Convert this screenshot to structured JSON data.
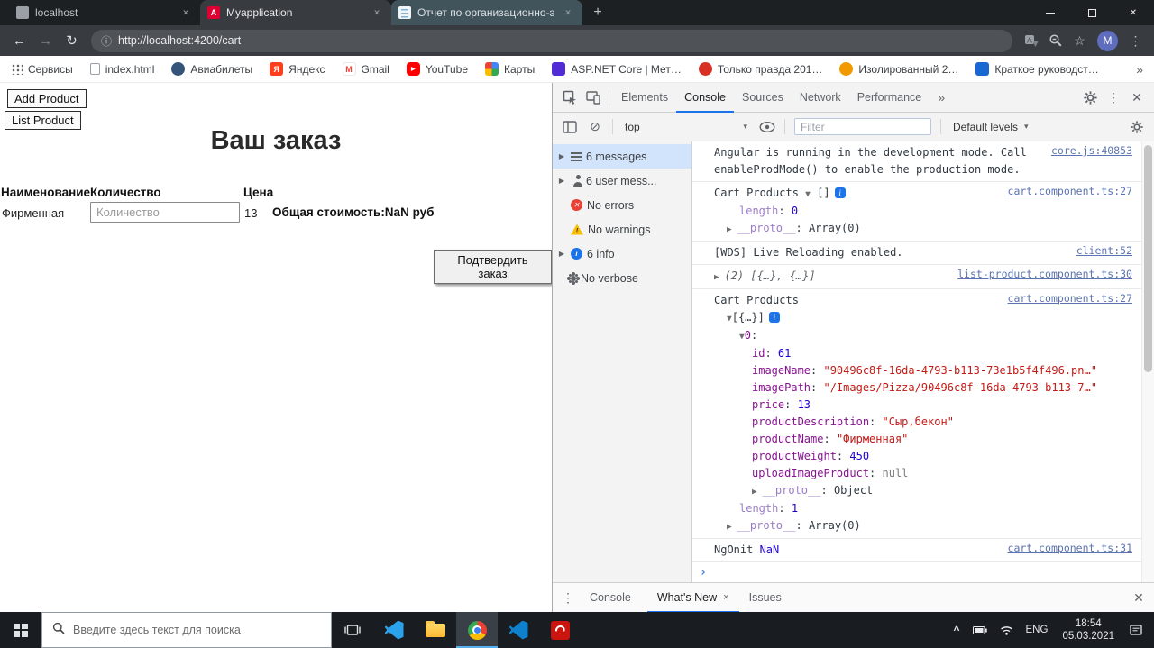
{
  "icons": {
    "new_tab": "+",
    "back": "←",
    "forward": "→",
    "reload": "↻",
    "info": "ⓘ",
    "star": "☆",
    "menu_dots": "⋮",
    "close": "✕",
    "overflow": "»",
    "caret_down": "▾",
    "block": "⊘",
    "prompt": "›",
    "chevron_up": "^"
  },
  "browser": {
    "tabs": [
      {
        "title": "localhost",
        "fav": "fav-page",
        "letter": ""
      },
      {
        "title": "Myapplication",
        "fav": "fav-angular",
        "letter": "A",
        "cls": "active"
      },
      {
        "title": "Отчет по организационно-экон",
        "fav": "fav-doc",
        "letter": "",
        "cls": "alt"
      }
    ],
    "url": "http://localhost:4200/cart",
    "profile_initial": "M",
    "bookmarks": [
      {
        "label": "Сервисы",
        "ic": "bm-apps"
      },
      {
        "label": "index.html",
        "ic": "bm-file"
      },
      {
        "label": "Авиабилеты",
        "ic": "bm-globe"
      },
      {
        "label": "Яндекс",
        "ic": "bm-yandex",
        "glyph": "Я"
      },
      {
        "label": "Gmail",
        "ic": "bm-gmail",
        "glyph": "M"
      },
      {
        "label": "YouTube",
        "ic": "bm-youtube",
        "glyph": "▶"
      },
      {
        "label": "Карты",
        "ic": "bm-maps"
      },
      {
        "label": "ASP.NET Core | Мет…",
        "ic": "bm-ms"
      },
      {
        "label": "Только правда 201…",
        "ic": "bm-red"
      },
      {
        "label": "Изолированный 2…",
        "ic": "bm-orange"
      },
      {
        "label": "Краткое руководст…",
        "ic": "bm-blue"
      }
    ]
  },
  "page": {
    "add_product_button": "Add Product",
    "list_product_button": "List Product",
    "title": "Ваш заказ",
    "headers": {
      "name": "Наименование",
      "qty": "Количество",
      "price": "Цена"
    },
    "row": {
      "name": "Фирменная",
      "qty_placeholder": "Количество",
      "price": "13"
    },
    "total": "Общая стоимость:NaN руб",
    "confirm_button": "Подтвердить заказ"
  },
  "devtools": {
    "tabs": [
      {
        "label": "Elements"
      },
      {
        "label": "Console",
        "cls": "active"
      },
      {
        "label": "Sources"
      },
      {
        "label": "Network"
      },
      {
        "label": "Performance"
      }
    ],
    "toolbar": {
      "context": "top",
      "filter_placeholder": "Filter",
      "levels_label": "Default levels"
    },
    "sidebar": [
      {
        "label": "6 messages",
        "ic": "ic-list",
        "caret": "▶",
        "cls": "selected"
      },
      {
        "label": "6 user mess...",
        "ic": "ic-user",
        "caret": "▶"
      },
      {
        "label": "No errors",
        "ic": "ic-error",
        "glyph": "✕"
      },
      {
        "label": "No warnings",
        "ic": "ic-warning",
        "glyph": "!"
      },
      {
        "label": "6 info",
        "ic": "ic-info",
        "glyph": "i",
        "caret": "▶"
      },
      {
        "label": "No verbose",
        "ic": "ic-verbose"
      }
    ],
    "entries": [
      {
        "link": "core.js:40853",
        "rows": [
          {
            "indent": 0,
            "parts": [
              {
                "t": "Angular is running in the development mode. Call enableProdMode() to enable the production mode.",
                "c": "tk-plain"
              }
            ]
          }
        ]
      },
      {
        "link": "cart.component.ts:27",
        "rows": [
          {
            "indent": 0,
            "parts": [
              {
                "t": "Cart Products ",
                "c": "tk-plain"
              },
              {
                "t": "▼",
                "c": "tk-caret"
              },
              {
                "t": " []",
                "c": "tk-plain"
              },
              {
                "t": "i",
                "c": "tk-badge"
              }
            ]
          },
          {
            "indent": 2,
            "parts": [
              {
                "t": "length",
                "c": "tk-dimkey"
              },
              {
                "t": ": ",
                "c": "tk-plain"
              },
              {
                "t": "0",
                "c": "tk-number"
              }
            ]
          },
          {
            "indent": 1,
            "parts": [
              {
                "t": "▶ ",
                "c": "tk-caret"
              },
              {
                "t": "__proto__",
                "c": "tk-dimkey"
              },
              {
                "t": ": ",
                "c": "tk-plain"
              },
              {
                "t": "Array(0)",
                "c": "tk-plain"
              }
            ]
          }
        ]
      },
      {
        "link": "client:52",
        "rows": [
          {
            "indent": 0,
            "parts": [
              {
                "t": "[WDS] Live Reloading enabled.",
                "c": "tk-plain"
              }
            ]
          }
        ]
      },
      {
        "link": "list-product.component.ts:30",
        "rows": [
          {
            "indent": 0,
            "parts": [
              {
                "t": "▶ ",
                "c": "tk-caret"
              },
              {
                "t": "(2) [{…}, {…}]",
                "c": "tk-preview"
              }
            ]
          }
        ]
      },
      {
        "link": "cart.component.ts:27",
        "rows": [
          {
            "indent": 0,
            "parts": [
              {
                "t": "Cart Products",
                "c": "tk-plain"
              }
            ]
          },
          {
            "indent": 1,
            "parts": [
              {
                "t": "▼",
                "c": "tk-caret"
              },
              {
                "t": "[{…}]",
                "c": "tk-plain"
              },
              {
                "t": "i",
                "c": "tk-badge"
              }
            ]
          },
          {
            "indent": 2,
            "parts": [
              {
                "t": "▼",
                "c": "tk-caret"
              },
              {
                "t": "0",
                "c": "tk-key"
              },
              {
                "t": ":",
                "c": "tk-plain"
              }
            ]
          },
          {
            "indent": 3,
            "parts": [
              {
                "t": "id",
                "c": "tk-key"
              },
              {
                "t": ": ",
                "c": "tk-plain"
              },
              {
                "t": "61",
                "c": "tk-number"
              }
            ]
          },
          {
            "indent": 3,
            "parts": [
              {
                "t": "imageName",
                "c": "tk-key"
              },
              {
                "t": ": ",
                "c": "tk-plain"
              },
              {
                "t": "\"90496c8f-16da-4793-b113-73e1b5f4f496.pn…\"",
                "c": "tk-string"
              }
            ]
          },
          {
            "indent": 3,
            "parts": [
              {
                "t": "imagePath",
                "c": "tk-key"
              },
              {
                "t": ": ",
                "c": "tk-plain"
              },
              {
                "t": "\"/Images/Pizza/90496c8f-16da-4793-b113-7…\"",
                "c": "tk-string"
              }
            ]
          },
          {
            "indent": 3,
            "parts": [
              {
                "t": "price",
                "c": "tk-key"
              },
              {
                "t": ": ",
                "c": "tk-plain"
              },
              {
                "t": "13",
                "c": "tk-number"
              }
            ]
          },
          {
            "indent": 3,
            "parts": [
              {
                "t": "productDescription",
                "c": "tk-key"
              },
              {
                "t": ": ",
                "c": "tk-plain"
              },
              {
                "t": "\"Сыр,бекон\"",
                "c": "tk-string"
              }
            ]
          },
          {
            "indent": 3,
            "parts": [
              {
                "t": "productName",
                "c": "tk-key"
              },
              {
                "t": ": ",
                "c": "tk-plain"
              },
              {
                "t": "\"Фирменная\"",
                "c": "tk-string"
              }
            ]
          },
          {
            "indent": 3,
            "parts": [
              {
                "t": "productWeight",
                "c": "tk-key"
              },
              {
                "t": ": ",
                "c": "tk-plain"
              },
              {
                "t": "450",
                "c": "tk-number"
              }
            ]
          },
          {
            "indent": 3,
            "parts": [
              {
                "t": "uploadImageProduct",
                "c": "tk-key"
              },
              {
                "t": ": ",
                "c": "tk-plain"
              },
              {
                "t": "null",
                "c": "tk-nullv"
              }
            ]
          },
          {
            "indent": 3,
            "parts": [
              {
                "t": "▶ ",
                "c": "tk-caret"
              },
              {
                "t": "__proto__",
                "c": "tk-dimkey"
              },
              {
                "t": ": ",
                "c": "tk-plain"
              },
              {
                "t": "Object",
                "c": "tk-plain"
              }
            ]
          },
          {
            "indent": 2,
            "parts": [
              {
                "t": "length",
                "c": "tk-dimkey"
              },
              {
                "t": ": ",
                "c": "tk-plain"
              },
              {
                "t": "1",
                "c": "tk-number"
              }
            ]
          },
          {
            "indent": 1,
            "parts": [
              {
                "t": "▶ ",
                "c": "tk-caret"
              },
              {
                "t": "__proto__",
                "c": "tk-dimkey"
              },
              {
                "t": ": ",
                "c": "tk-plain"
              },
              {
                "t": "Array(0)",
                "c": "tk-plain"
              }
            ]
          }
        ]
      },
      {
        "link": "cart.component.ts:31",
        "rows": [
          {
            "indent": 0,
            "parts": [
              {
                "t": "NgOnit ",
                "c": "tk-plain"
              },
              {
                "t": "NaN",
                "c": "tk-number"
              }
            ]
          }
        ]
      }
    ],
    "drawer": {
      "tabs": [
        {
          "label": "Console"
        },
        {
          "label": "What's New",
          "cls": "active",
          "close": "×"
        },
        {
          "label": "Issues"
        }
      ]
    }
  },
  "taskbar": {
    "search_placeholder": "Введите здесь текст для поиска",
    "apps": [
      {
        "icon": "visual-studio-icon",
        "logo": "logo-vs"
      },
      {
        "icon": "file-explorer-icon",
        "logo": "logo-folder"
      },
      {
        "icon": "chrome-icon",
        "logo": "logo-chrome",
        "cls": "active"
      },
      {
        "icon": "vscode-icon",
        "logo": "logo-vscode"
      },
      {
        "icon": "acrobat-icon",
        "logo": "logo-acrobat"
      }
    ],
    "tray": {
      "language": "ENG",
      "time": "18:54",
      "date": "05.03.2021"
    }
  }
}
